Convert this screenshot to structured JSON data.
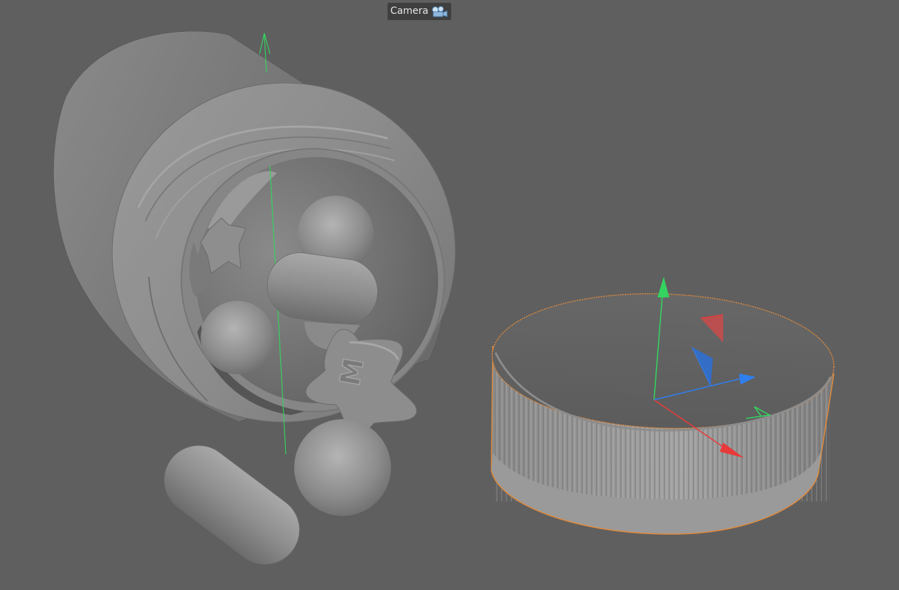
{
  "viewport": {
    "camera_label": "Camera",
    "camera_icon": "camera-icon",
    "background": "#5f5f5f"
  },
  "scene": {
    "objects": [
      "pill-bottle",
      "capsule",
      "sphere-pill",
      "star-pill",
      "bottle-cap"
    ],
    "star_pill_engraving": "M",
    "selection_color": "#e08a3c",
    "axis_colors": {
      "x": "#e83a3a",
      "y": "#35d35f",
      "z": "#2f7ff0"
    }
  }
}
